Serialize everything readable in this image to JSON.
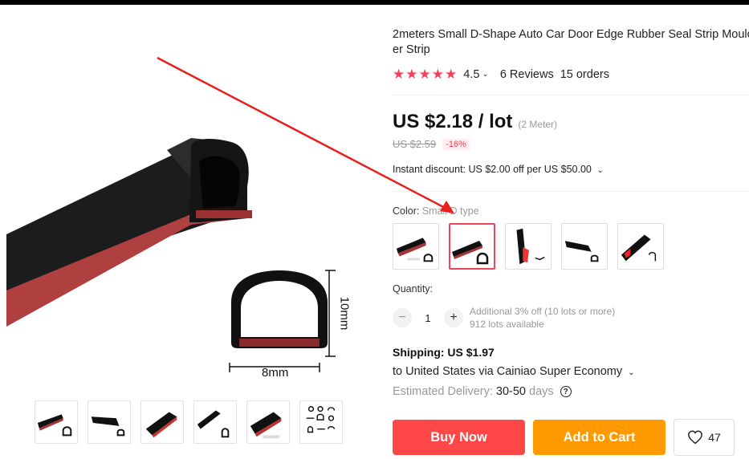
{
  "product": {
    "title_line1": "2meters Small D-Shape Auto Car Door Edge Rubber Seal Strip Moulc",
    "title_line2": "er Strip",
    "rating": "4.5",
    "reviews": "6 Reviews",
    "orders": "15 orders",
    "star_color": "#f2425a"
  },
  "price": {
    "current": "US $2.18 / lot",
    "unit_note": "(2 Meter)",
    "original": "US $2.59",
    "discount": "-16%",
    "instant_discount": "Instant discount: US $2.00 off per US $50.00"
  },
  "image_dims": {
    "height": "10mm",
    "width": "8mm"
  },
  "color": {
    "label": "Color:",
    "value": "Small D type",
    "swatches": [
      "swatch-1",
      "swatch-2",
      "swatch-3",
      "swatch-4",
      "swatch-5"
    ],
    "selected_index": 1
  },
  "quantity": {
    "label": "Quantity:",
    "value": "1",
    "additional": "Additional 3% off (10 lots or more)",
    "available": "912 lots available"
  },
  "shipping": {
    "title": "Shipping: US $1.97",
    "route": "to United States via Cainiao Super Economy",
    "delivery_label": "Estimated Delivery:",
    "delivery_value": "30-50",
    "delivery_unit": "days"
  },
  "actions": {
    "buy_now": "Buy Now",
    "add_to_cart": "Add to Cart",
    "wishlist_count": "47",
    "buy_color": "#ff4747",
    "cart_color": "#ff9900"
  },
  "icons": {
    "chevron": "chevron-down-icon",
    "help": "help-icon",
    "heart": "heart-icon",
    "minus": "minus-icon",
    "plus": "plus-icon"
  },
  "gallery": {
    "thumbnails": [
      "thumb-1",
      "thumb-2",
      "thumb-3",
      "thumb-4",
      "thumb-5",
      "thumb-6"
    ]
  }
}
